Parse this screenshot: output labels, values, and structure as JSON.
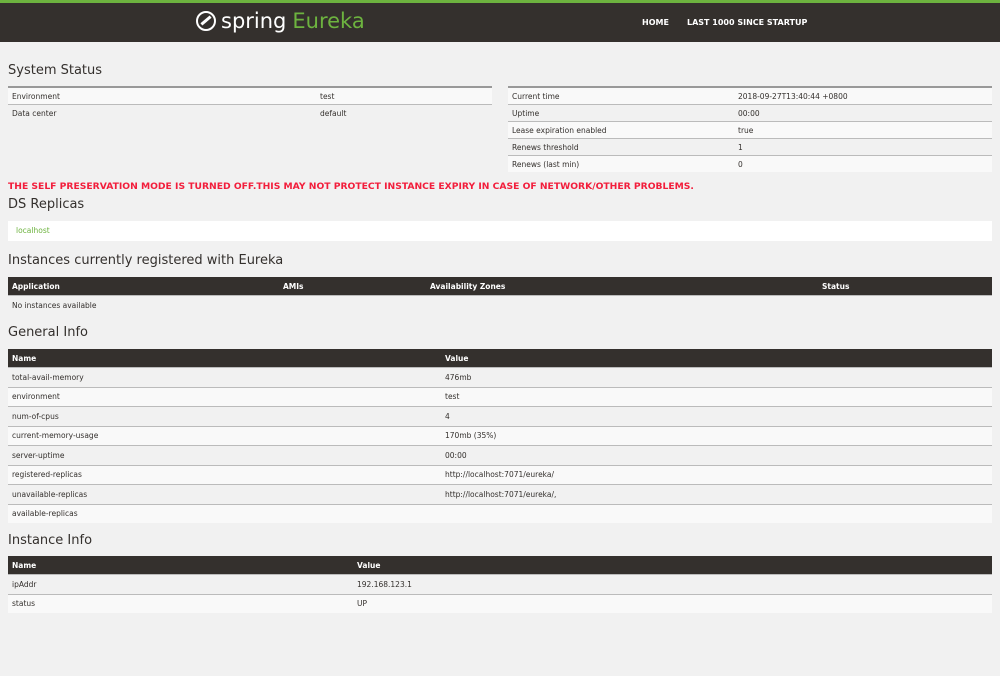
{
  "header": {
    "logo_spring": "spring",
    "logo_eureka": "Eureka",
    "nav": [
      "HOME",
      "LAST 1000 SINCE STARTUP"
    ]
  },
  "system_status": {
    "title": "System Status",
    "left": [
      [
        "Environment",
        "test"
      ],
      [
        "Data center",
        "default"
      ]
    ],
    "right": [
      [
        "Current time",
        "2018-09-27T13:40:44 +0800"
      ],
      [
        "Uptime",
        "00:00"
      ],
      [
        "Lease expiration enabled",
        "true"
      ],
      [
        "Renews threshold",
        "1"
      ],
      [
        "Renews (last min)",
        "0"
      ]
    ]
  },
  "warning": "THE SELF PRESERVATION MODE IS TURNED OFF.THIS MAY NOT PROTECT INSTANCE EXPIRY IN CASE OF NETWORK/OTHER PROBLEMS.",
  "ds_replicas": {
    "title": "DS Replicas",
    "items": [
      "localhost"
    ]
  },
  "instances": {
    "title": "Instances currently registered with Eureka",
    "columns": [
      "Application",
      "AMIs",
      "Availability Zones",
      "Status"
    ],
    "empty": "No instances available"
  },
  "general_info": {
    "title": "General Info",
    "columns": [
      "Name",
      "Value"
    ],
    "rows": [
      [
        "total-avail-memory",
        "476mb"
      ],
      [
        "environment",
        "test"
      ],
      [
        "num-of-cpus",
        "4"
      ],
      [
        "current-memory-usage",
        "170mb (35%)"
      ],
      [
        "server-uptime",
        "00:00"
      ],
      [
        "registered-replicas",
        "http://localhost:7071/eureka/"
      ],
      [
        "unavailable-replicas",
        "http://localhost:7071/eureka/,"
      ],
      [
        "available-replicas",
        ""
      ]
    ]
  },
  "instance_info": {
    "title": "Instance Info",
    "columns": [
      "Name",
      "Value"
    ],
    "rows": [
      [
        "ipAddr",
        "192.168.123.1"
      ],
      [
        "status",
        "UP"
      ]
    ]
  }
}
